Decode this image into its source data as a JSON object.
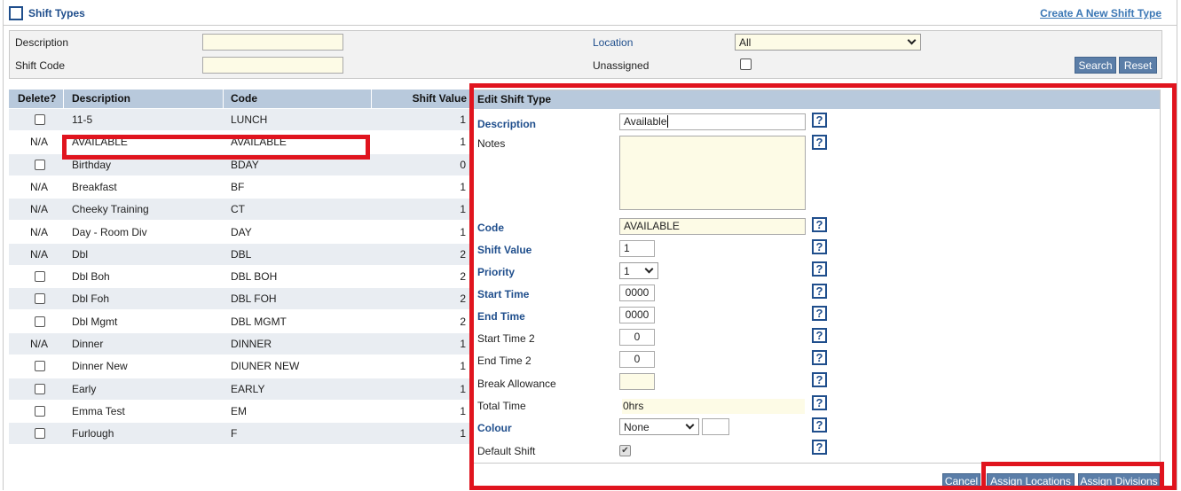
{
  "header": {
    "title": "Shift Types",
    "create_link": "Create A New Shift Type"
  },
  "search": {
    "description_label": "Description",
    "description_value": "",
    "shift_code_label": "Shift Code",
    "shift_code_value": "",
    "location_label": "Location",
    "location_value": "All",
    "unassigned_label": "Unassigned",
    "search_button": "Search",
    "reset_button": "Reset"
  },
  "table": {
    "headers": [
      "Delete?",
      "Description",
      "Code",
      "Shift Value"
    ],
    "rows": [
      {
        "delete": "checkbox",
        "description": "11-5",
        "code": "LUNCH",
        "value": "1"
      },
      {
        "delete": "N/A",
        "description": "AVAILABLE",
        "code": "AVAILABLE",
        "value": "1"
      },
      {
        "delete": "checkbox",
        "description": "Birthday",
        "code": "BDAY",
        "value": "0"
      },
      {
        "delete": "N/A",
        "description": "Breakfast",
        "code": "BF",
        "value": "1"
      },
      {
        "delete": "N/A",
        "description": "Cheeky Training",
        "code": "CT",
        "value": "1"
      },
      {
        "delete": "N/A",
        "description": "Day - Room Div",
        "code": "DAY",
        "value": "1"
      },
      {
        "delete": "N/A",
        "description": "Dbl",
        "code": "DBL",
        "value": "2"
      },
      {
        "delete": "checkbox",
        "description": "Dbl Boh",
        "code": "DBL BOH",
        "value": "2"
      },
      {
        "delete": "checkbox",
        "description": "Dbl Foh",
        "code": "DBL FOH",
        "value": "2"
      },
      {
        "delete": "checkbox",
        "description": "Dbl Mgmt",
        "code": "DBL MGMT",
        "value": "2"
      },
      {
        "delete": "N/A",
        "description": "Dinner",
        "code": "DINNER",
        "value": "1"
      },
      {
        "delete": "checkbox",
        "description": "Dinner New",
        "code": "DIUNER NEW",
        "value": "1"
      },
      {
        "delete": "checkbox",
        "description": "Early",
        "code": "EARLY",
        "value": "1"
      },
      {
        "delete": "checkbox",
        "description": "Emma Test",
        "code": "EM",
        "value": "1"
      },
      {
        "delete": "checkbox",
        "description": "Furlough",
        "code": "F",
        "value": "1"
      }
    ]
  },
  "edit": {
    "title": "Edit Shift Type",
    "help_glyph": "?",
    "description_label": "Description",
    "description_value": "Available",
    "notes_label": "Notes",
    "notes_value": "",
    "code_label": "Code",
    "code_value": "AVAILABLE",
    "shift_value_label": "Shift Value",
    "shift_value": "1",
    "priority_label": "Priority",
    "priority_value": "1",
    "start_time_label": "Start Time",
    "start_time_value": "0000",
    "end_time_label": "End Time",
    "end_time_value": "0000",
    "start_time2_label": "Start Time 2",
    "start_time2_value": "0",
    "end_time2_label": "End Time 2",
    "end_time2_value": "0",
    "break_label": "Break Allowance",
    "break_value": "",
    "total_time_label": "Total Time",
    "total_time_value": "0hrs",
    "colour_label": "Colour",
    "colour_value": "None",
    "default_shift_label": "Default Shift",
    "default_shift_checked": true,
    "cancel_button": "Cancel",
    "assign_locations_button": "Assign Locations",
    "assign_divisions_button": "Assign Divisions"
  },
  "colors": {
    "accent": "#1f4e8c",
    "header_bg": "#b8c9dc",
    "button_bg": "#5b7ea8",
    "highlight": "#e0141e",
    "input_bg": "#fdfbe6"
  }
}
